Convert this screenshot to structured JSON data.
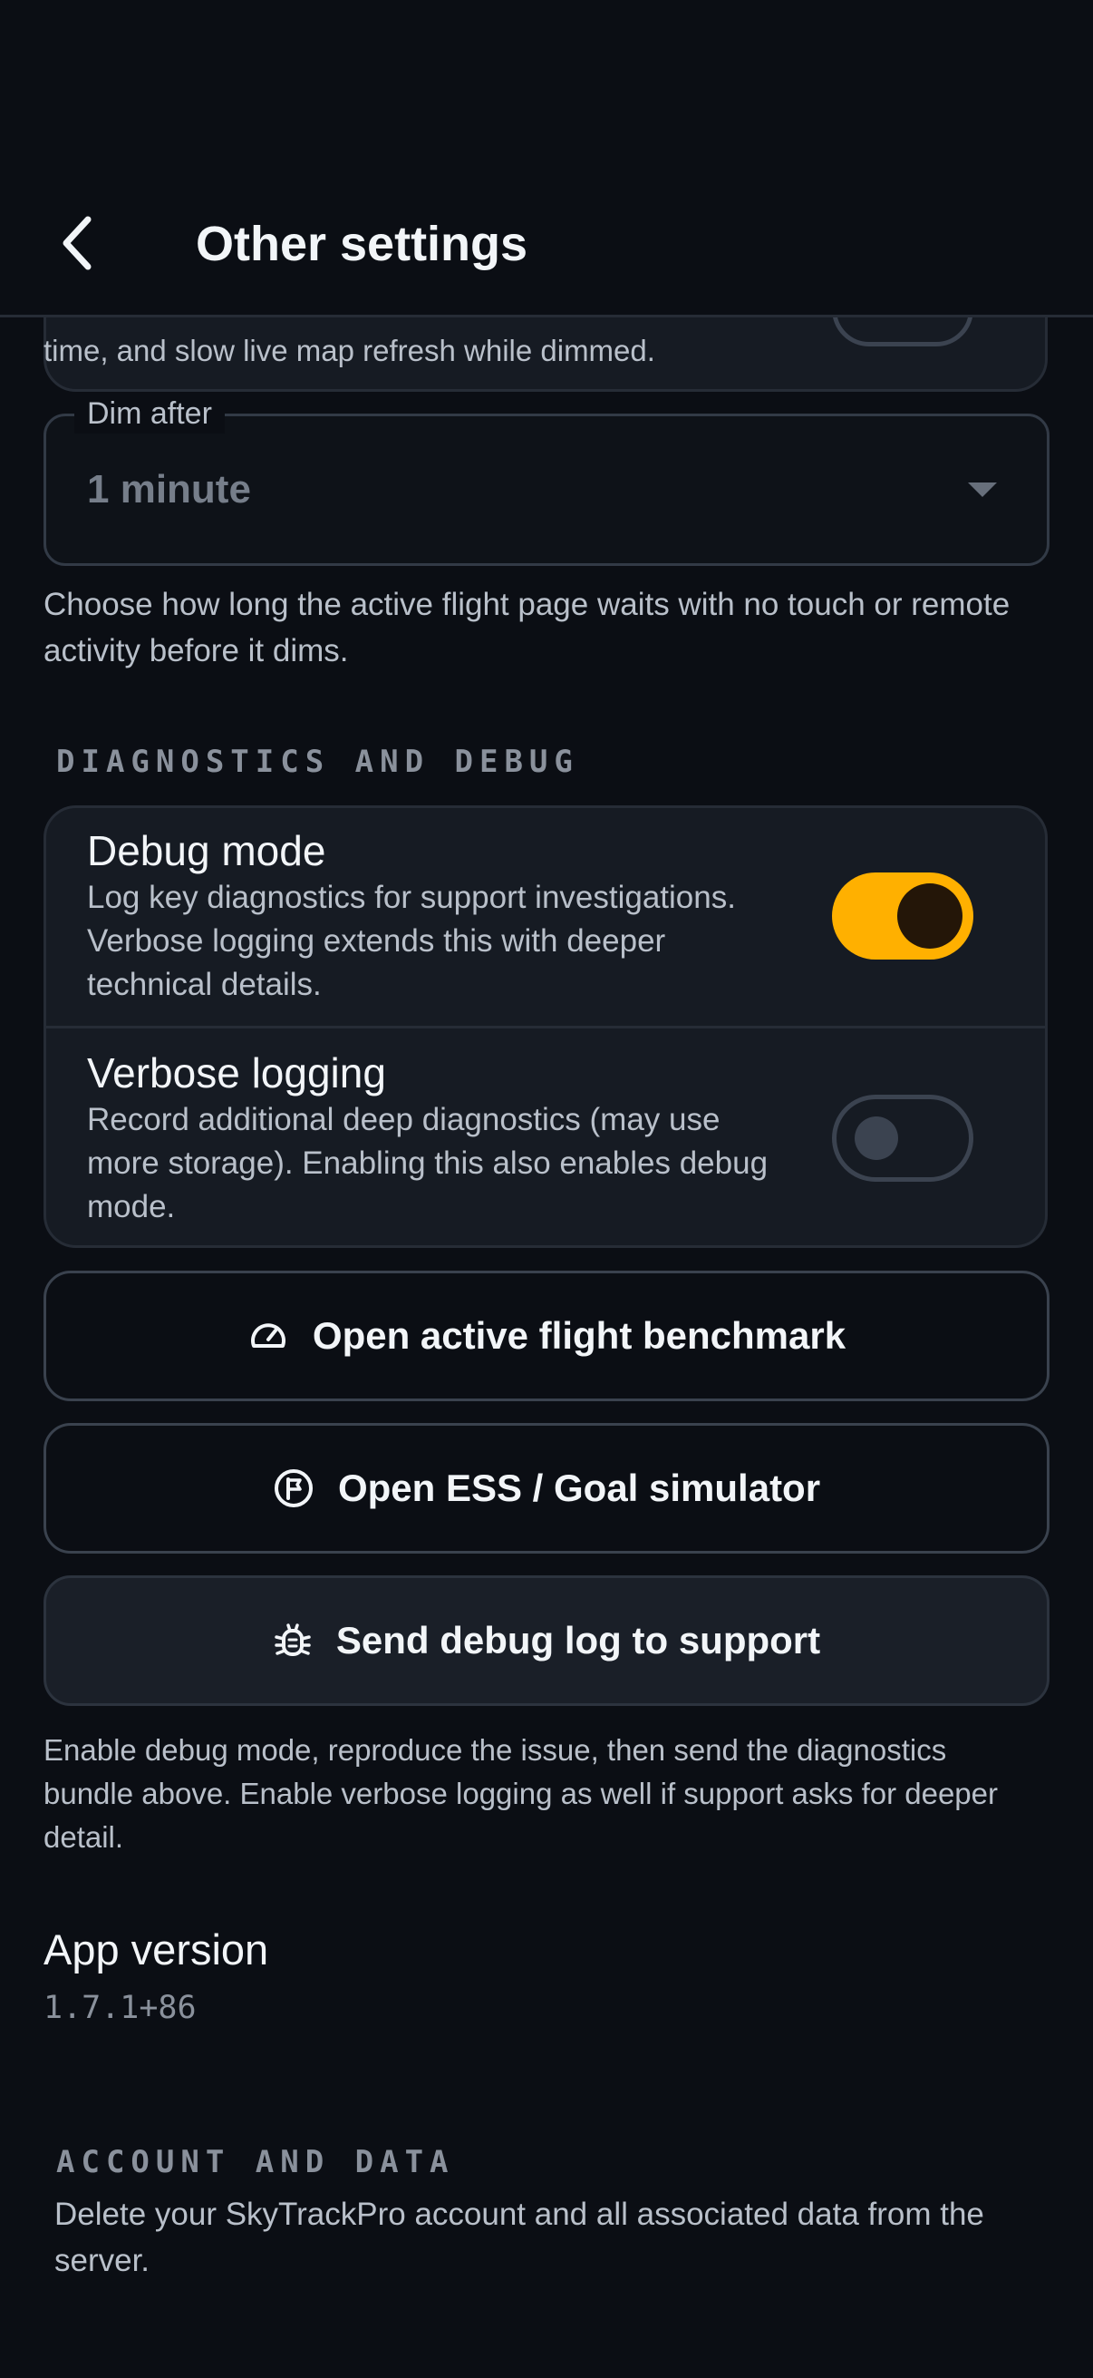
{
  "header": {
    "title": "Other settings",
    "back_icon": "chevron-left-icon"
  },
  "dim_card": {
    "description_tail": "time, and slow live map refresh while dimmed.",
    "toggle_on": false
  },
  "dim_after": {
    "label": "Dim after",
    "value": "1 minute",
    "help": "Choose how long the active flight page waits with no touch or remote activity before it dims."
  },
  "diagnostics": {
    "section_title": "DIAGNOSTICS AND DEBUG",
    "debug_mode": {
      "title": "Debug mode",
      "description": "Log key diagnostics for support investigations. Verbose logging extends this with deeper technical details.",
      "on": true
    },
    "verbose_logging": {
      "title": "Verbose logging",
      "description": "Record additional deep diagnostics (may use more storage). Enabling this also enables debug mode.",
      "on": false
    },
    "benchmark_button": {
      "label": "Open active flight benchmark",
      "icon": "gauge-icon"
    },
    "simulator_button": {
      "label": "Open ESS / Goal simulator",
      "icon": "goal-flag-icon"
    },
    "send_log_button": {
      "label": "Send debug log to support",
      "icon": "bug-icon"
    },
    "help": "Enable debug mode, reproduce the issue, then send the diagnostics bundle above. Enable verbose logging as well if support asks for deeper detail."
  },
  "app_version": {
    "title": "App version",
    "value": "1.7.1+86"
  },
  "account": {
    "section_title": "ACCOUNT AND DATA",
    "description": "Delete your SkyTrackPro account and all associated data from the server."
  },
  "colors": {
    "background": "#0b0e14",
    "card": "#161b23",
    "accent": "#ffb000"
  }
}
